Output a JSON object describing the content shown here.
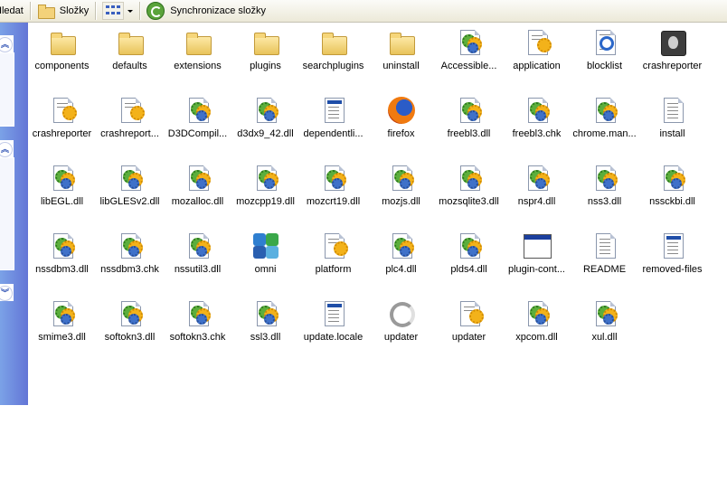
{
  "toolbar": {
    "search_label": "Hledat",
    "folders_label": "Složky",
    "sync_label": "Synchronizace složky"
  },
  "files": [
    {
      "label": "components",
      "icon": "folder-icon"
    },
    {
      "label": "defaults",
      "icon": "folder-icon"
    },
    {
      "label": "extensions",
      "icon": "folder-icon"
    },
    {
      "label": "plugins",
      "icon": "folder-icon"
    },
    {
      "label": "searchplugins",
      "icon": "folder-icon"
    },
    {
      "label": "uninstall",
      "icon": "folder-icon"
    },
    {
      "label": "Accessible...",
      "icon": "dll-icon"
    },
    {
      "label": "application",
      "icon": "ini-icon"
    },
    {
      "label": "blocklist",
      "icon": "xml-icon"
    },
    {
      "label": "crashreporter",
      "icon": "crashreporter-icon"
    },
    {
      "label": "crashreporter",
      "icon": "ini-icon"
    },
    {
      "label": "crashreport...",
      "icon": "ini-icon"
    },
    {
      "label": "D3DCompil...",
      "icon": "dll-icon"
    },
    {
      "label": "d3dx9_42.dll",
      "icon": "dll-icon"
    },
    {
      "label": "dependentli...",
      "icon": "list-file-icon"
    },
    {
      "label": "firefox",
      "icon": "firefox-icon"
    },
    {
      "label": "freebl3.dll",
      "icon": "dll-icon"
    },
    {
      "label": "freebl3.chk",
      "icon": "dll-icon"
    },
    {
      "label": "chrome.man...",
      "icon": "dll-icon"
    },
    {
      "label": "install",
      "icon": "text-file-icon"
    },
    {
      "label": "libEGL.dll",
      "icon": "dll-icon"
    },
    {
      "label": "libGLESv2.dll",
      "icon": "dll-icon"
    },
    {
      "label": "mozalloc.dll",
      "icon": "dll-icon"
    },
    {
      "label": "mozcpp19.dll",
      "icon": "dll-icon"
    },
    {
      "label": "mozcrt19.dll",
      "icon": "dll-icon"
    },
    {
      "label": "mozjs.dll",
      "icon": "dll-icon"
    },
    {
      "label": "mozsqlite3.dll",
      "icon": "dll-icon"
    },
    {
      "label": "nspr4.dll",
      "icon": "dll-icon"
    },
    {
      "label": "nss3.dll",
      "icon": "dll-icon"
    },
    {
      "label": "nssckbi.dll",
      "icon": "dll-icon"
    },
    {
      "label": "nssdbm3.dll",
      "icon": "dll-icon"
    },
    {
      "label": "nssdbm3.chk",
      "icon": "dll-icon"
    },
    {
      "label": "nssutil3.dll",
      "icon": "dll-icon"
    },
    {
      "label": "omni",
      "icon": "omni-icon"
    },
    {
      "label": "platform",
      "icon": "ini-icon"
    },
    {
      "label": "plc4.dll",
      "icon": "dll-icon"
    },
    {
      "label": "plds4.dll",
      "icon": "dll-icon"
    },
    {
      "label": "plugin-cont...",
      "icon": "window-exe-icon"
    },
    {
      "label": "README",
      "icon": "text-file-icon"
    },
    {
      "label": "removed-files",
      "icon": "list-file-icon"
    },
    {
      "label": "smime3.dll",
      "icon": "dll-icon"
    },
    {
      "label": "softokn3.dll",
      "icon": "dll-icon"
    },
    {
      "label": "softokn3.chk",
      "icon": "dll-icon"
    },
    {
      "label": "ssl3.dll",
      "icon": "dll-icon"
    },
    {
      "label": "update.locale",
      "icon": "list-file-icon"
    },
    {
      "label": "updater",
      "icon": "updater-icon"
    },
    {
      "label": "updater",
      "icon": "ini-icon"
    },
    {
      "label": "xpcom.dll",
      "icon": "dll-icon"
    },
    {
      "label": "xul.dll",
      "icon": "dll-icon"
    }
  ]
}
